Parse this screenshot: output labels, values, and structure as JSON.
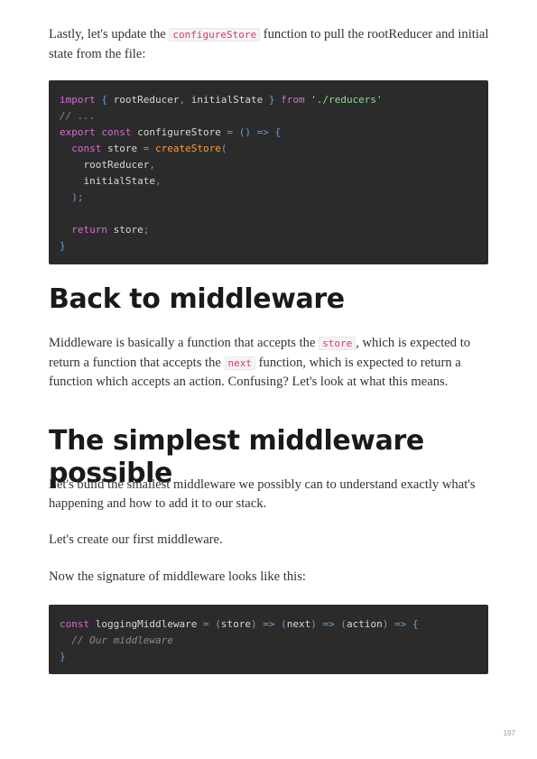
{
  "intro_paragraph": {
    "before": "Lastly, let's update the ",
    "code": "configureStore",
    "after": " function to pull the rootReducer and initial state from the file:"
  },
  "code_block_1": [
    [
      {
        "t": "import",
        "c": "kw"
      },
      {
        "t": " "
      },
      {
        "t": "{",
        "c": "pn"
      },
      {
        "t": " rootReducer"
      },
      {
        "t": ",",
        "c": "pn"
      },
      {
        "t": " initialState "
      },
      {
        "t": "}",
        "c": "pn"
      },
      {
        "t": " "
      },
      {
        "t": "from",
        "c": "kw"
      },
      {
        "t": " "
      },
      {
        "t": "'./reducers'",
        "c": "st"
      }
    ],
    [
      {
        "t": "// ...",
        "c": "cm"
      }
    ],
    [
      {
        "t": "export",
        "c": "kw"
      },
      {
        "t": " "
      },
      {
        "t": "const",
        "c": "kw"
      },
      {
        "t": " configureStore "
      },
      {
        "t": "=",
        "c": "pn"
      },
      {
        "t": " "
      },
      {
        "t": "()",
        "c": "pn"
      },
      {
        "t": " "
      },
      {
        "t": "=>",
        "c": "pn"
      },
      {
        "t": " "
      },
      {
        "t": "{",
        "c": "pn"
      }
    ],
    [
      {
        "t": "  "
      },
      {
        "t": "const",
        "c": "kw"
      },
      {
        "t": " store "
      },
      {
        "t": "=",
        "c": "pn"
      },
      {
        "t": " "
      },
      {
        "t": "createStore",
        "c": "fn"
      },
      {
        "t": "(",
        "c": "pn"
      }
    ],
    [
      {
        "t": "    rootReducer"
      },
      {
        "t": ",",
        "c": "pn"
      }
    ],
    [
      {
        "t": "    initialState"
      },
      {
        "t": ",",
        "c": "pn"
      }
    ],
    [
      {
        "t": "  "
      },
      {
        "t": ");",
        "c": "pn"
      }
    ],
    [
      {
        "t": ""
      }
    ],
    [
      {
        "t": "  "
      },
      {
        "t": "return",
        "c": "kw"
      },
      {
        "t": " store"
      },
      {
        "t": ";",
        "c": "pn"
      }
    ],
    [
      {
        "t": "}",
        "c": "pn"
      }
    ]
  ],
  "heading_1": "Back to middleware",
  "middleware_paragraph": {
    "part1": "Middleware is basically a function that accepts the ",
    "code1": "store",
    "part2": ", which is expected to return a function that accepts the ",
    "code2": "next",
    "part3": " function, which is expected to return a function which accepts an action. Confusing? Let's look at what this means."
  },
  "heading_2": "The simplest middleware possible",
  "paragraph_build": "Let's build the smallest middleware we possibly can to understand exactly what's happening and how to add it to our stack.",
  "paragraph_create": "Let's create our first middleware.",
  "paragraph_signature": "Now the signature of middleware looks like this:",
  "code_block_2": [
    [
      {
        "t": "const",
        "c": "kw"
      },
      {
        "t": " loggingMiddleware "
      },
      {
        "t": "=",
        "c": "pn"
      },
      {
        "t": " "
      },
      {
        "t": "(",
        "c": "pn"
      },
      {
        "t": "store"
      },
      {
        "t": ")",
        "c": "pn"
      },
      {
        "t": " "
      },
      {
        "t": "=>",
        "c": "pn"
      },
      {
        "t": " "
      },
      {
        "t": "(",
        "c": "pn"
      },
      {
        "t": "next"
      },
      {
        "t": ")",
        "c": "pn"
      },
      {
        "t": " "
      },
      {
        "t": "=>",
        "c": "pn"
      },
      {
        "t": " "
      },
      {
        "t": "(",
        "c": "pn"
      },
      {
        "t": "action"
      },
      {
        "t": ")",
        "c": "pn"
      },
      {
        "t": " "
      },
      {
        "t": "=>",
        "c": "pn"
      },
      {
        "t": " "
      },
      {
        "t": "{",
        "c": "pn"
      }
    ],
    [
      {
        "t": "  "
      },
      {
        "t": "// Our middleware",
        "c": "cm"
      }
    ],
    [
      {
        "t": "}",
        "c": "pn"
      }
    ]
  ],
  "page_number": "197"
}
